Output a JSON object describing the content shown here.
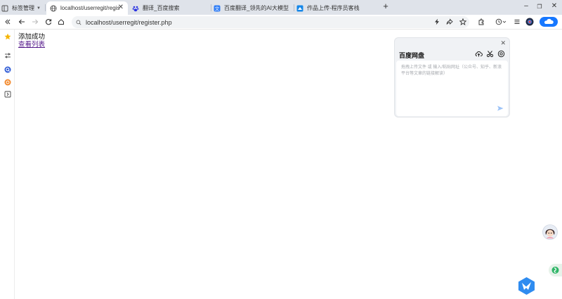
{
  "tabs": [
    {
      "label": "标签管理",
      "active": false
    },
    {
      "label": "localhost/userregit/registe",
      "active": true
    },
    {
      "label": "翻译_百度搜索",
      "active": false
    },
    {
      "label": "百度翻译_领先的AI大模型翻译",
      "active": false
    },
    {
      "label": "作品上传-程序员客栈",
      "active": false
    }
  ],
  "new_tab_glyph": "+",
  "close_glyph": "✕",
  "window_buttons": {
    "minimize": "–",
    "restore": "❐",
    "close": "✕"
  },
  "address": {
    "url": "localhost/userregit/register.php"
  },
  "page": {
    "message": "添加成功",
    "link": "查看列表"
  },
  "netdisk": {
    "title": "百度网盘",
    "placeholder": "拖拽上传文件 或 输入/粘贴网址（公众号、知乎、新浪平台等文章的链接解读）",
    "close": "✕"
  },
  "colors": {
    "tabstrip": "#dfe3ea",
    "link": "#551a8b",
    "accent_blue": "#1677ff",
    "star": "#f5b400"
  },
  "icons": {
    "toolbar": [
      "back-icon",
      "forward-icon",
      "reload-icon",
      "home-icon",
      "search-icon",
      "lightning-icon",
      "share-icon",
      "star-icon",
      "extensions-icon",
      "history-icon",
      "menu-icon",
      "avatar",
      "cloud-sync-icon"
    ],
    "sidebar": [
      "collapse-icon",
      "favorites-star-icon",
      "settings-sliders-icon",
      "search-q-icon",
      "bookmark-app-icon",
      "download-icon"
    ],
    "netdisk": [
      "upload-cloud-icon",
      "scissors-icon",
      "settings-icon",
      "send-icon"
    ]
  }
}
